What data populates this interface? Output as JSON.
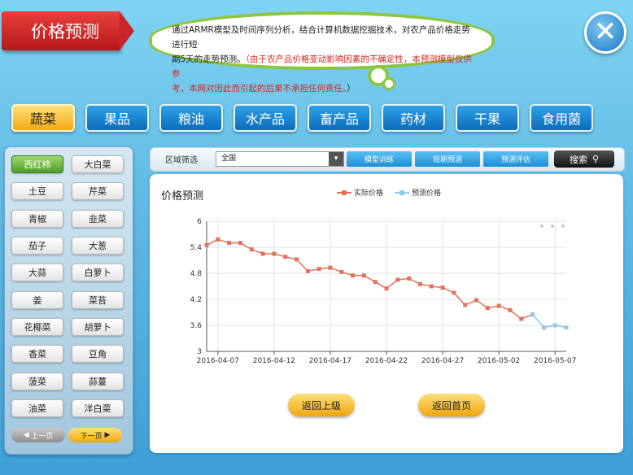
{
  "header": {
    "title": "价格预测",
    "notice_line1": "通过ARMR模型及时间序列分析，结合计算机数据挖掘技术，对农产品价格走势进行短",
    "notice_line2_a": "期5天的走势预测。",
    "notice_line2_b": "（由于农产品价格变动影响因素的不确定性，本预测模型仅供参",
    "notice_line3_a": "考，本网对因此而引起的后果不承担任何责任。",
    "notice_line3_b": "）"
  },
  "categories": [
    "蔬菜",
    "果品",
    "粮油",
    "水产品",
    "畜产品",
    "药材",
    "干果",
    "食用菌"
  ],
  "vegetables": [
    "西红柿",
    "大白菜",
    "土豆",
    "芹菜",
    "青椒",
    "韭菜",
    "茄子",
    "大葱",
    "大蒜",
    "白萝卜",
    "姜",
    "菜苔",
    "花椰菜",
    "胡萝卜",
    "香菜",
    "豆角",
    "菠菜",
    "蒜薹",
    "油菜",
    "洋白菜"
  ],
  "pager": {
    "prev": "上一页",
    "next": "下一页"
  },
  "filter": {
    "label": "区域筛选",
    "region": "全国",
    "buttons": [
      "模型训练",
      "短期预测",
      "预测评估"
    ],
    "search": "搜索"
  },
  "panel": {
    "title": "价格预测",
    "back": "返回上级",
    "home": "返回首页"
  },
  "colors": {
    "actual": "#e2735a",
    "predicted": "#8fc9ea"
  },
  "chart_data": {
    "type": "line",
    "title": "价格预测",
    "ylim": [
      3,
      6
    ],
    "yticks": [
      "3",
      "3.6",
      "4.2",
      "4.8",
      "5.4",
      "6"
    ],
    "xticks": [
      "2016-04-07",
      "2016-04-12",
      "2016-04-17",
      "2016-04-22",
      "2016-04-27",
      "2016-05-02",
      "2016-05-07"
    ],
    "legend": [
      "实际价格",
      "预测价格"
    ],
    "series": [
      {
        "name": "实际价格",
        "x_start": "2016-04-06",
        "values": [
          5.45,
          5.58,
          5.5,
          5.5,
          5.35,
          5.25,
          5.25,
          5.18,
          5.12,
          4.85,
          4.9,
          4.93,
          4.83,
          4.75,
          4.75,
          4.6,
          4.45,
          4.65,
          4.68,
          4.55,
          4.5,
          4.47,
          4.35,
          4.07,
          4.18,
          4.0,
          4.05,
          3.95,
          3.75,
          3.85
        ]
      },
      {
        "name": "预测价格",
        "x_start": "2016-05-05",
        "values": [
          3.85,
          3.55,
          3.6,
          3.55
        ]
      }
    ]
  }
}
